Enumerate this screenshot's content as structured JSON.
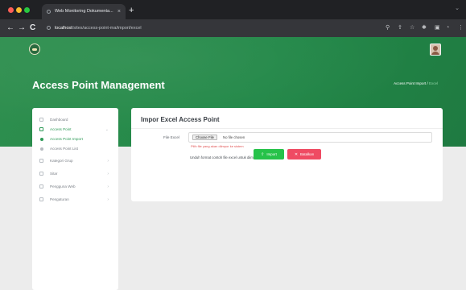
{
  "browser": {
    "tab_title": "Web Monitoring Dokumenta...",
    "tab_close": "×",
    "new_tab": "+",
    "window_control": "⌄",
    "nav_back": "←",
    "nav_forward": "→",
    "nav_reload": "C",
    "url_host": "localhost",
    "url_path": "/sites/access-point-ma/import/excel"
  },
  "header": {
    "title": "Access Point Management",
    "breadcrumb_parent": "Access Point Import",
    "breadcrumb_sep": "/",
    "breadcrumb_current": "Excel"
  },
  "sidebar": {
    "items": [
      {
        "label": "Dashboard",
        "icon": "home-icon"
      },
      {
        "label": "Access Point",
        "icon": "wifi-icon",
        "chevron": "⌄"
      },
      {
        "label": "Access Point Import",
        "icon": "dot-icon"
      },
      {
        "label": "Access Point List",
        "icon": "dot-icon"
      },
      {
        "label": "Kategori Grup",
        "icon": "folder-icon",
        "chevron": "›"
      },
      {
        "label": "Sitar",
        "icon": "list-icon",
        "chevron": "›"
      },
      {
        "label": "Pengguna Web",
        "icon": "users-icon",
        "chevron": "›"
      },
      {
        "label": "Pengaturan",
        "icon": "gear-icon",
        "chevron": "›"
      }
    ]
  },
  "form": {
    "title": "Impor Excel Access Point",
    "file_label": "File Excel",
    "choose_file": "Choose File",
    "file_status": "No file chosen",
    "helper_text": "Pilih file yang akan diimpor ke sistem",
    "hint_text": "Unduh format contoh file excel untuk diimpor",
    "hint_link": "Unduh",
    "import_button": "Import",
    "cancel_button": "Batalkan"
  },
  "colors": {
    "brand_green": "#228848",
    "active_menu": "#2e9a57",
    "import_button": "#27c24a",
    "cancel_button": "#ef4b63",
    "link": "#2f6fd1"
  }
}
